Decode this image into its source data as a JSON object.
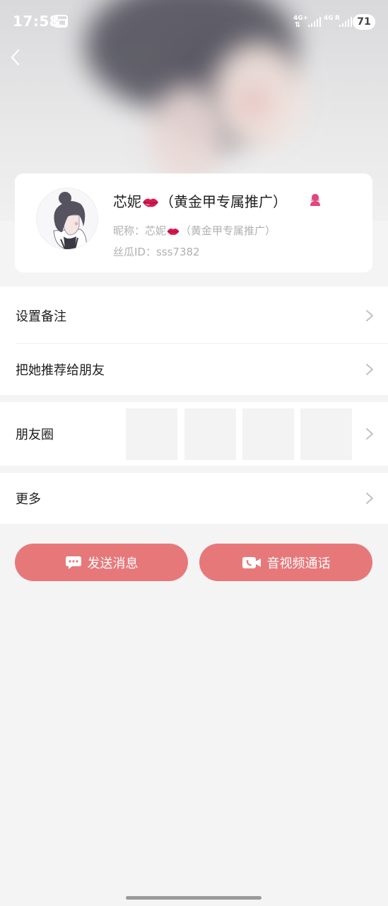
{
  "status_bar": {
    "time": "17:58",
    "network_1": "4G+",
    "network_2": "4G",
    "roaming": "R",
    "battery": "71"
  },
  "profile": {
    "name": "芯妮",
    "name_suffix": "（黄金甲专属推广）",
    "nickname_label": "昵称：",
    "nickname": "芯妮",
    "nickname_suffix": "（黄金甲专属推广）",
    "id_label": "丝瓜ID：",
    "id_value": "sss7382",
    "gender_icon": "female-user-icon",
    "name_emoji": "lips-emoji"
  },
  "menu": {
    "set_remark": "设置备注",
    "recommend": "把她推荐给朋友",
    "moments": "朋友圈",
    "more": "更多"
  },
  "actions": {
    "send_message": "发送消息",
    "video_call": "音视频通话"
  },
  "colors": {
    "accent": "#e7787a",
    "gender_icon": "#e2467f",
    "lips": "#d8194f"
  }
}
